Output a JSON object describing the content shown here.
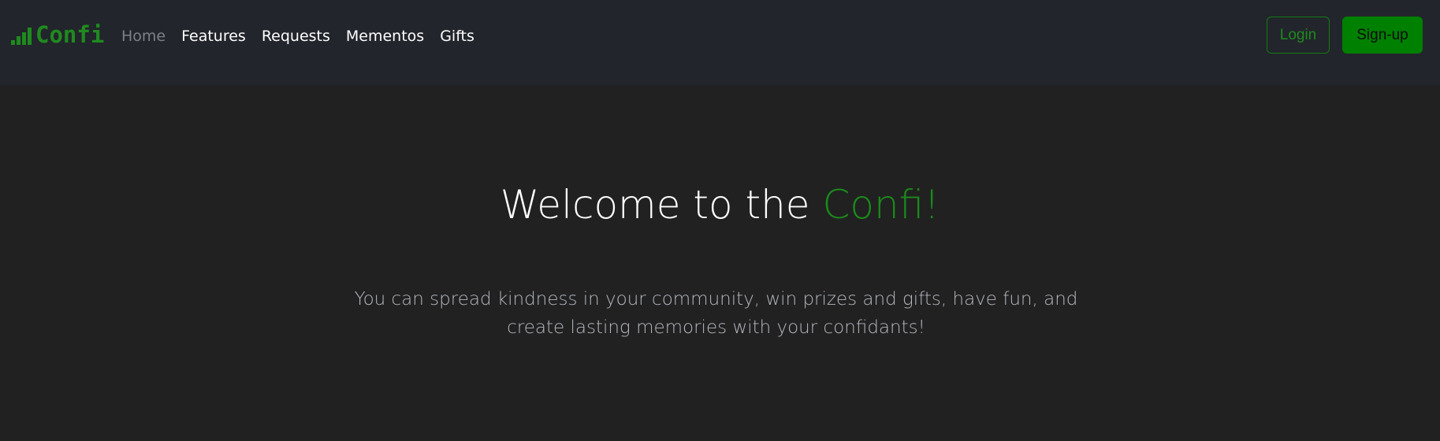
{
  "brand": {
    "name": "Confi",
    "logo_icon": "signal-bars-icon",
    "accent_color": "#1f8a1f"
  },
  "nav": {
    "items": [
      {
        "label": "Home",
        "active": true
      },
      {
        "label": "Features"
      },
      {
        "label": "Requests"
      },
      {
        "label": "Mementos"
      },
      {
        "label": "Gifts"
      }
    ]
  },
  "auth": {
    "login_label": "Login",
    "signup_label": "Sign-up"
  },
  "hero": {
    "title_prefix": "Welcome to the ",
    "title_accent": "Confi!",
    "subtitle": "You can spread kindness in your community, win prizes and gifts, have fun, and create lasting memories with your confidants!"
  },
  "colors": {
    "navbar_bg": "#22252b",
    "page_bg": "#212121",
    "brand_green": "#008000"
  }
}
